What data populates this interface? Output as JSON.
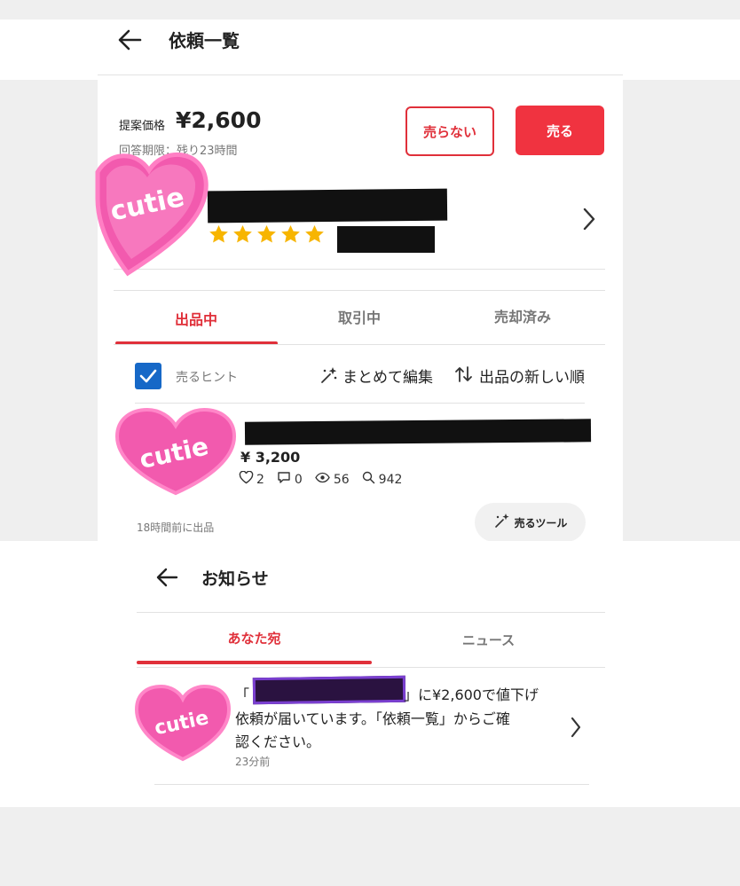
{
  "request_screen": {
    "title": "依頼一覧",
    "offer_label": "提案価格",
    "offer_price": "¥2,600",
    "deadline": "回答期限：残り23時間",
    "decline_button": "売らない",
    "sell_button": "売る",
    "rating_stars": 5
  },
  "listing_tabs": [
    {
      "label": "出品中",
      "active": true
    },
    {
      "label": "取引中",
      "active": false
    },
    {
      "label": "売却済み",
      "active": false
    }
  ],
  "toolbar": {
    "hint_label": "売るヒント",
    "hint_checked": true,
    "bulk_edit": "まとめて編集",
    "sort": "出品の新しい順"
  },
  "item": {
    "price": "¥ 3,200",
    "likes": "2",
    "comments": "0",
    "views": "56",
    "searches": "942",
    "listed_time": "18時間前に出品",
    "sell_tool_button": "売るツール"
  },
  "notifications_screen": {
    "title": "お知らせ",
    "tabs": [
      {
        "label": "あなた宛",
        "active": true
      },
      {
        "label": "ニュース",
        "active": false
      }
    ],
    "notice": {
      "open_quote": "「",
      "text_after_name": "」に¥2,600で値下げ",
      "line2": "依頼が届いています。「依頼一覧」からご確",
      "line3": "認ください。",
      "time": "23分前"
    }
  },
  "heart_sticker_text": "cutie",
  "colors": {
    "accent": "#e0303a",
    "star": "#f7b500",
    "heart": "#f25aae",
    "checkbox": "#1668c7",
    "redaction": "#111111"
  }
}
